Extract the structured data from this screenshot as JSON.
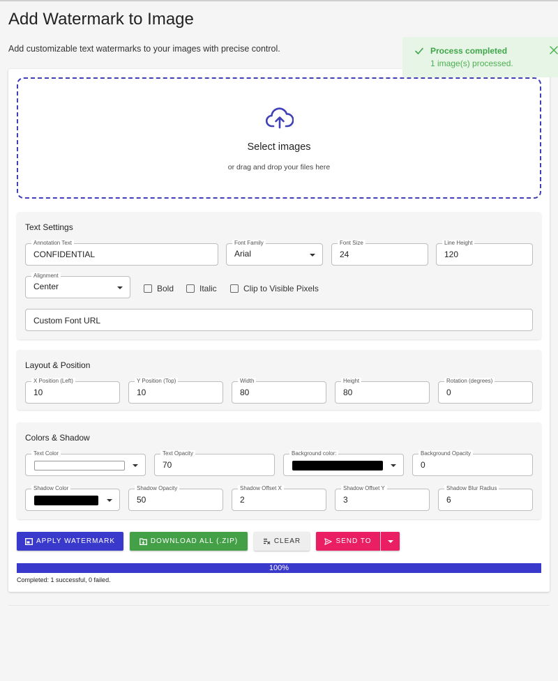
{
  "header": {
    "title": "Add Watermark to Image",
    "description": "Add customizable text watermarks to your images with precise control."
  },
  "toast": {
    "title": "Process completed",
    "message": "1 image(s) processed."
  },
  "dropzone": {
    "title": "Select images",
    "subtitle": "or drag and drop your files here"
  },
  "text_settings": {
    "title": "Text Settings",
    "annotation_text": {
      "label": "Annotation Text",
      "value": "CONFIDENTIAL"
    },
    "font_family": {
      "label": "Font Family",
      "value": "Arial"
    },
    "font_size": {
      "label": "Font Size",
      "value": "24"
    },
    "line_height": {
      "label": "Line Height",
      "value": "120"
    },
    "alignment": {
      "label": "Alignment",
      "value": "Center"
    },
    "bold": "Bold",
    "italic": "Italic",
    "clip": "Clip to Visible Pixels",
    "custom_font_url": {
      "placeholder": "Custom Font URL"
    }
  },
  "layout": {
    "title": "Layout & Position",
    "x": {
      "label": "X Position (Left)",
      "value": "10"
    },
    "y": {
      "label": "Y Position (Top)",
      "value": "10"
    },
    "width": {
      "label": "Width",
      "value": "80"
    },
    "height": {
      "label": "Height",
      "value": "80"
    },
    "rotation": {
      "label": "Rotation (degrees)",
      "value": "0"
    }
  },
  "colors": {
    "title": "Colors & Shadow",
    "text_color": {
      "label": "Text Color",
      "color": "#ffffff"
    },
    "text_opacity": {
      "label": "Text Opacity",
      "value": "70"
    },
    "background_color": {
      "label": "Background color:",
      "color": "#000000"
    },
    "background_opacity": {
      "label": "Background Opacity",
      "value": "0"
    },
    "shadow_color": {
      "label": "Shadow Color",
      "color": "#000000"
    },
    "shadow_opacity": {
      "label": "Shadow Opacity",
      "value": "50"
    },
    "shadow_offset_x": {
      "label": "Shadow Offset X",
      "value": "2"
    },
    "shadow_offset_y": {
      "label": "Shadow Offset Y",
      "value": "3"
    },
    "shadow_blur": {
      "label": "Shadow Blur Radius",
      "value": "6"
    }
  },
  "actions": {
    "apply": "APPLY WATERMARK",
    "download": "DOWNLOAD ALL (.ZIP)",
    "clear": "CLEAR",
    "send_to": "SEND TO"
  },
  "progress": {
    "percent": 100,
    "label": "100%",
    "status": "Completed: 1 successful, 0 failed."
  },
  "colors_theme": {
    "primary": "#3939cc",
    "success": "#43a047",
    "pink": "#e91e63"
  }
}
